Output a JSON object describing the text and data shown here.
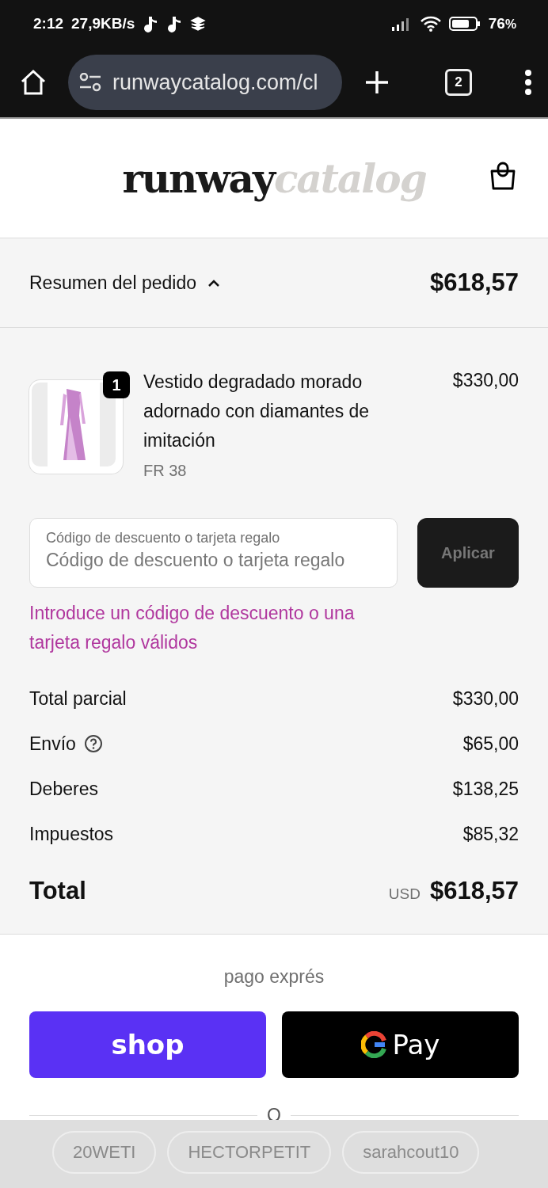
{
  "status_bar": {
    "time": "2:12",
    "speed": "27,9KB/s",
    "battery": "76",
    "battery_unit": "%"
  },
  "browser": {
    "url": "runwaycatalog.com/cl",
    "tab_count": "2"
  },
  "header": {
    "logo_dark": "runway",
    "logo_light": "catalog"
  },
  "summary": {
    "label": "Resumen del pedido",
    "expanded": true,
    "total": "$618,57"
  },
  "items": [
    {
      "name": "Vestido degradado morado adornado con diamantes de imitación",
      "variant": "FR 38",
      "quantity": "1",
      "price": "$330,00"
    }
  ],
  "discount": {
    "label": "Código de descuento o tarjeta regalo",
    "placeholder": "Código de descuento o tarjeta regalo",
    "button": "Aplicar",
    "disabled": true,
    "error": "Introduce un código de descuento o una tarjeta regalo válidos"
  },
  "lines": [
    {
      "label": "Total parcial",
      "value": "$330,00",
      "help": false
    },
    {
      "label": "Envío",
      "value": "$65,00",
      "help": true
    },
    {
      "label": "Deberes",
      "value": "$138,25",
      "help": false
    },
    {
      "label": "Impuestos",
      "value": "$85,32",
      "help": false
    }
  ],
  "total": {
    "label": "Total",
    "currency": "USD",
    "value": "$618,57"
  },
  "express": {
    "title": "pago exprés",
    "buttons": [
      {
        "kind": "shop",
        "label": "shop"
      },
      {
        "kind": "gpay",
        "label": "Pay"
      }
    ],
    "divider": "O"
  },
  "keyboard_suggestions": [
    "20WETI",
    "HECTORPETIT",
    "sarahcout10"
  ]
}
